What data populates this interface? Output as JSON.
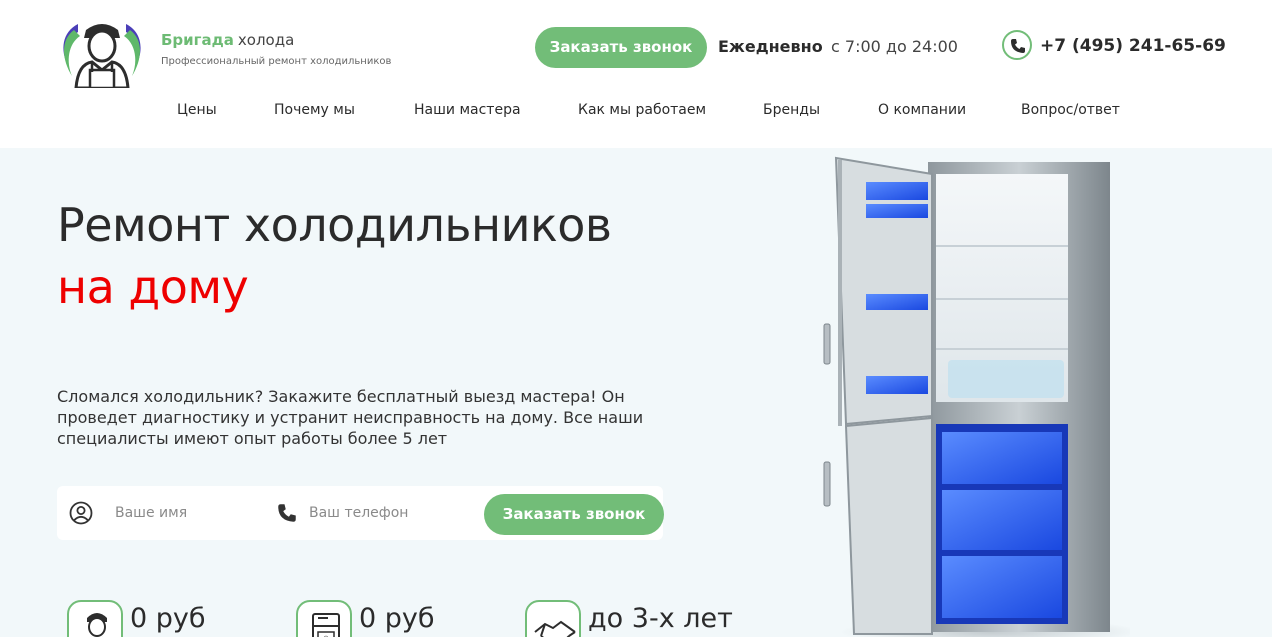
{
  "header": {
    "brand_name": "Бригада",
    "brand_suffix": "холода",
    "tagline": "Профессиональный ремонт холодильников",
    "callback_button": "Заказать звонок",
    "schedule_label": "Ежедневно",
    "schedule_hours": "с 7:00 до 24:00",
    "phone": "+7 (495) 241-65-69",
    "phone_icon": "phone-icon"
  },
  "nav": {
    "items": [
      {
        "label": "Цены"
      },
      {
        "label": "Почему мы"
      },
      {
        "label": "Наши мастера"
      },
      {
        "label": "Как мы работаем"
      },
      {
        "label": "Бренды"
      },
      {
        "label": "О компании"
      },
      {
        "label": "Вопрос/ответ"
      }
    ]
  },
  "hero": {
    "title_line1": "Ремонт холодильников",
    "title_line2": "на дому",
    "description": "Сломался холодильник? Закажите бесплатный выезд мастера! Он проведет диагностику и устранит неисправность на дому. Все наши специалисты имеют опыт работы более 5 лет",
    "form": {
      "name_placeholder": "Ваше имя",
      "name_value": "",
      "phone_placeholder": "Ваш телефон",
      "phone_value": "",
      "submit_label": "Заказать звонок"
    },
    "features": [
      {
        "icon": "technician-icon",
        "value": "0 руб"
      },
      {
        "icon": "fridge-icon",
        "value": "0 руб"
      },
      {
        "icon": "handshake-icon",
        "value": "до 3-х лет"
      }
    ]
  },
  "colors": {
    "accent_green": "#72bd78",
    "accent_red": "#ee0000",
    "hero_background": "#f2f8fa",
    "text_dark": "#2b2b2b"
  }
}
